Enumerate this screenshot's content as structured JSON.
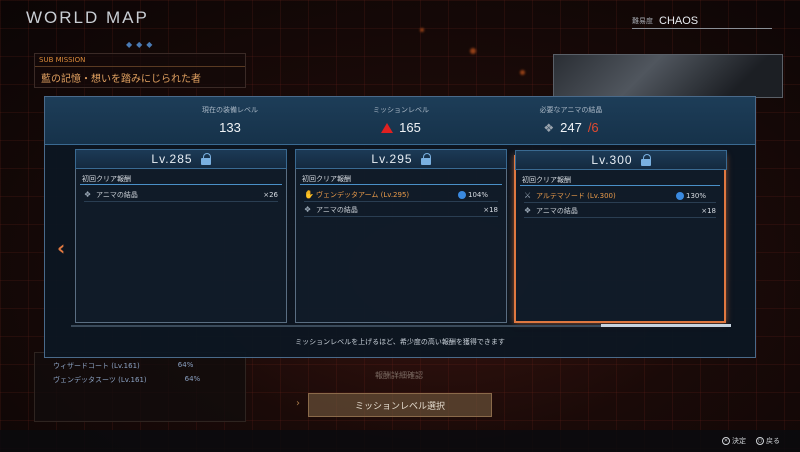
{
  "screen": {
    "title": "WORLD MAP"
  },
  "difficulty": {
    "label": "難易度",
    "value": "CHAOS"
  },
  "sub_mission": {
    "tag": "SUB MISSION",
    "name": "藍の記憶・想いを踏みにじられた者"
  },
  "stats": [
    {
      "label": "現在の装備レベル",
      "value": "133"
    },
    {
      "label": "ミッションレベル",
      "value": "165"
    },
    {
      "label": "必要なアニマの結晶",
      "value": "247",
      "value_suffix": "/6"
    }
  ],
  "cards": [
    {
      "level": "Lv.285",
      "section": "初回クリア報酬",
      "rewards": [
        {
          "icon": "crystal-icon",
          "name": "アニマの結晶",
          "pct": "",
          "qty": "×26"
        }
      ]
    },
    {
      "level": "Lv.295",
      "section": "初回クリア報酬",
      "rewards": [
        {
          "icon": "gauntlet-icon",
          "name": "ヴェンデッタアーム (Lv.295)",
          "pct": "104%",
          "qty": ""
        },
        {
          "icon": "crystal-icon",
          "name": "アニマの結晶",
          "pct": "",
          "qty": "×18"
        }
      ]
    },
    {
      "level": "Lv.300",
      "section": "初回クリア報酬",
      "rewards": [
        {
          "icon": "sword-icon",
          "name": "アルテマソード (Lv.300)",
          "pct": "130%",
          "qty": ""
        },
        {
          "icon": "crystal-icon",
          "name": "アニマの結晶",
          "pct": "",
          "qty": "×18"
        }
      ]
    }
  ],
  "hint": "ミッションレベルを上げるほど、希少度の高い報酬を獲得できます",
  "background_list": [
    {
      "name": "ウィザードコート (Lv.161)",
      "pct": "64%"
    },
    {
      "name": "ヴェンデッタスーツ (Lv.161)",
      "pct": "64%"
    }
  ],
  "buttons": {
    "details": "報酬詳細確認",
    "select": "ミッションレベル選択"
  },
  "footer": {
    "confirm": "決定",
    "back": "戻る"
  },
  "colors": {
    "accent_orange": "#e07840",
    "panel_blue": "#1d3d58",
    "warning_red": "#e02020"
  }
}
